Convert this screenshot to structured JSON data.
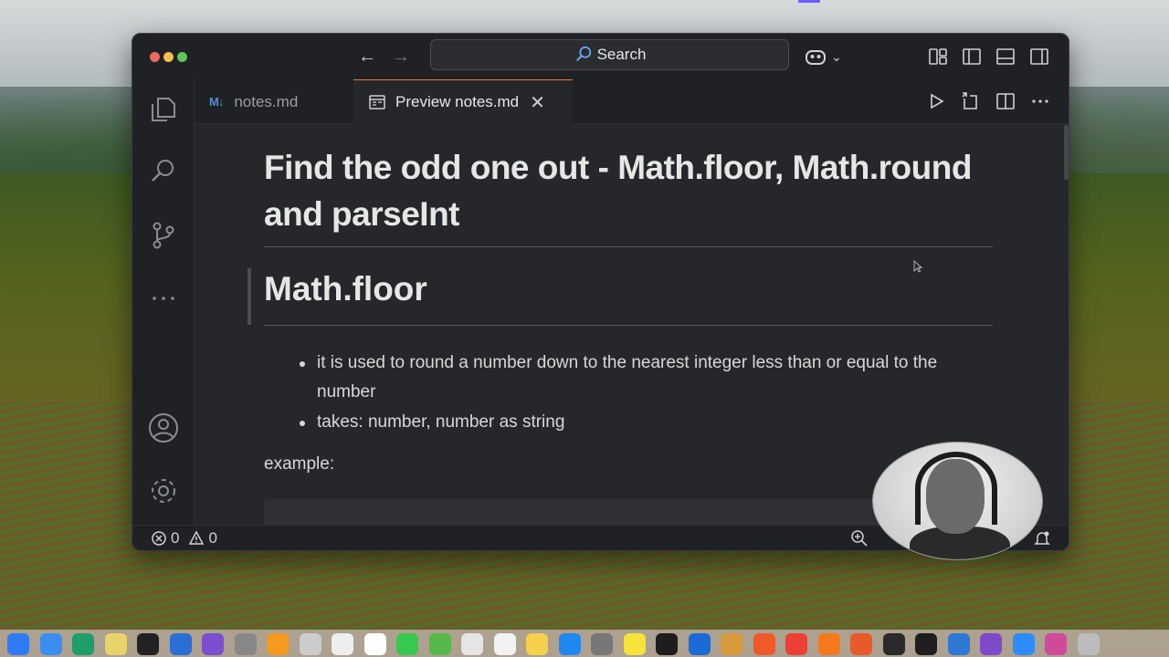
{
  "window": {
    "search_label": "Search"
  },
  "tabs": [
    {
      "label": "notes.md",
      "icon": "markdown-icon",
      "active": false
    },
    {
      "label": "Preview notes.md",
      "icon": "preview-icon",
      "active": true
    }
  ],
  "markdown_icon_text": "M↓",
  "content": {
    "h1": "Find the odd one out - Math.floor, Math.round and parseInt",
    "h2": "Math.floor",
    "bullets": [
      "it is used to round a number down to the nearest integer less than or equal to the number",
      "takes: number, number as string"
    ],
    "example_label": "example:"
  },
  "statusbar": {
    "errors": "0",
    "warnings": "0"
  },
  "colors": {
    "accent_tab_border": "#e07a3f",
    "editor_bg": "#25272b",
    "chrome_bg": "#1f2124"
  }
}
